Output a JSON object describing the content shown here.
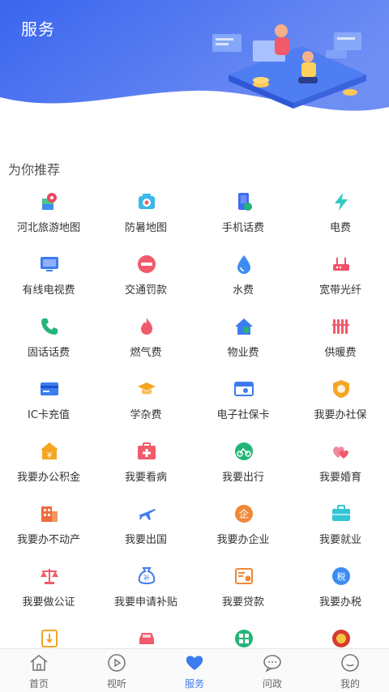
{
  "header": {
    "title": "服务"
  },
  "section": {
    "title": "为你推荐"
  },
  "services": [
    {
      "label": "河北旅游地图",
      "icon": "map-pin-icon",
      "color": "#e94c5f"
    },
    {
      "label": "防暑地图",
      "icon": "camera-icon",
      "color": "#3ab8e8"
    },
    {
      "label": "手机话费",
      "icon": "phone-icon",
      "color": "#3d6df0"
    },
    {
      "label": "电费",
      "icon": "lightning-icon",
      "color": "#34c9c4"
    },
    {
      "label": "有线电视费",
      "icon": "tv-icon",
      "color": "#3d7cf0"
    },
    {
      "label": "交通罚款",
      "icon": "no-entry-icon",
      "color": "#f05a6a"
    },
    {
      "label": "水费",
      "icon": "water-drop-icon",
      "color": "#3d8df0"
    },
    {
      "label": "宽带光纤",
      "icon": "router-icon",
      "color": "#f0506a"
    },
    {
      "label": "固话话费",
      "icon": "telephone-icon",
      "color": "#22b577"
    },
    {
      "label": "燃气费",
      "icon": "flame-icon",
      "color": "#f05a6a"
    },
    {
      "label": "物业费",
      "icon": "house-icon",
      "color": "#3d7cf0"
    },
    {
      "label": "供暖费",
      "icon": "radiator-icon",
      "color": "#f05a6a"
    },
    {
      "label": "IC卡充值",
      "icon": "card-icon",
      "color": "#3d7cf0"
    },
    {
      "label": "学杂费",
      "icon": "graduation-cap-icon",
      "color": "#f5a623"
    },
    {
      "label": "电子社保卡",
      "icon": "id-card-icon",
      "color": "#3d7cf0"
    },
    {
      "label": "我要办社保",
      "icon": "shield-icon",
      "color": "#f5a623"
    },
    {
      "label": "我要办公积金",
      "icon": "yen-house-icon",
      "color": "#f5a623"
    },
    {
      "label": "我要看病",
      "icon": "medical-kit-icon",
      "color": "#f05a6a"
    },
    {
      "label": "我要出行",
      "icon": "bicycle-icon",
      "color": "#22b577"
    },
    {
      "label": "我要婚育",
      "icon": "hearts-icon",
      "color": "#f05a6a"
    },
    {
      "label": "我要办不动产",
      "icon": "building-icon",
      "color": "#f06a3a"
    },
    {
      "label": "我要出国",
      "icon": "airplane-icon",
      "color": "#3d7cf0"
    },
    {
      "label": "我要办企业",
      "icon": "enterprise-icon",
      "color": "#f0883a"
    },
    {
      "label": "我要就业",
      "icon": "briefcase-icon",
      "color": "#34c4d4"
    },
    {
      "label": "我要做公证",
      "icon": "scales-icon",
      "color": "#f05a6a"
    },
    {
      "label": "我要申请补贴",
      "icon": "money-bag-icon",
      "color": "#3d7cf0"
    },
    {
      "label": "我要贷款",
      "icon": "loan-form-icon",
      "color": "#f0883a"
    },
    {
      "label": "我要办税",
      "icon": "tax-icon",
      "color": "#3d8df0"
    },
    {
      "label": "",
      "icon": "document-icon",
      "color": "#f5a623"
    },
    {
      "label": "",
      "icon": "car-icon",
      "color": "#f05a6a"
    },
    {
      "label": "",
      "icon": "apps-icon",
      "color": "#22b577"
    },
    {
      "label": "",
      "icon": "emblem-icon",
      "color": "#d93a2f"
    }
  ],
  "bottom_nav": [
    {
      "label": "首页",
      "icon": "home-icon"
    },
    {
      "label": "视听",
      "icon": "play-icon"
    },
    {
      "label": "服务",
      "icon": "heart-icon",
      "active": true
    },
    {
      "label": "问政",
      "icon": "chat-icon"
    },
    {
      "label": "我的",
      "icon": "profile-icon"
    }
  ],
  "colors": {
    "header_gradient_start": "#3d6df0",
    "header_gradient_end": "#6b8ff5",
    "active_nav": "#3d7cf0"
  }
}
